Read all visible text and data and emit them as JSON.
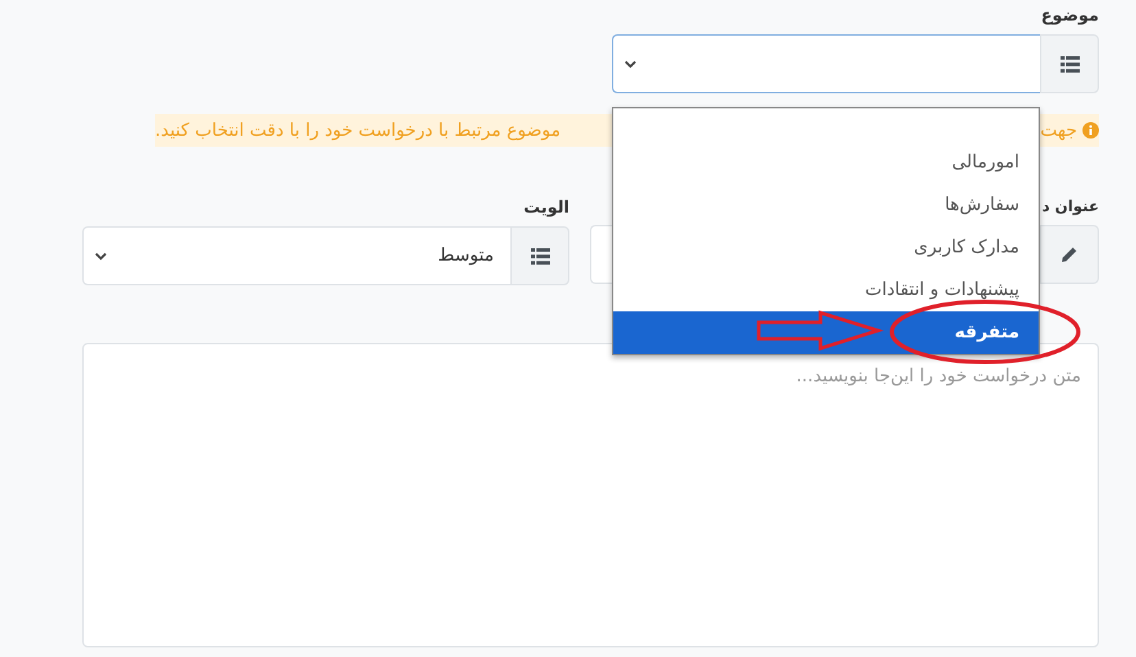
{
  "subject": {
    "label": "موضوع",
    "options": [
      {
        "label": "امورمالی",
        "selected": false
      },
      {
        "label": "سفارش‌ها",
        "selected": false
      },
      {
        "label": "مدارک کاربری",
        "selected": false
      },
      {
        "label": "پیشنهادات و انتقادات",
        "selected": false
      },
      {
        "label": "متفرقه",
        "selected": true
      }
    ]
  },
  "alert": {
    "text_start": "جهت",
    "text_end": "موضوع مرتبط با درخواست خود را با دقت انتخاب کنید."
  },
  "title": {
    "label": "عنوان د"
  },
  "priority": {
    "label": "الویت",
    "value": "متوسط"
  },
  "message": {
    "placeholder": "متن درخواست خود را این‌جا بنویسید..."
  }
}
